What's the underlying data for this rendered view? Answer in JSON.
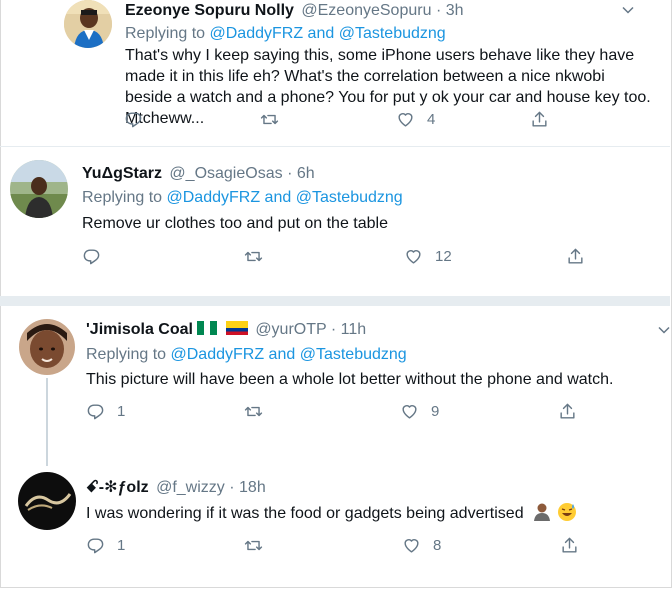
{
  "tweets": [
    {
      "name": "Ezeonye Sopuru Nolly",
      "handle": "@EzeonyeSopuru",
      "time": "· 3h",
      "replying_prefix": "Replying to",
      "reply_user1": "@DaddyFRZ",
      "reply_and": "and",
      "reply_user2": "@Tastebudzng",
      "text": "That's why I keep saying this, some iPhone users behave like they have made it in this life eh? What's the correlation between a nice nkwobi beside a watch and a phone? You for put y ok your car and house key too. Mtcheww...",
      "reply_count": "",
      "retweet_count": "",
      "like_count": "4"
    },
    {
      "name": "YuΔgStarz",
      "handle": "@_OsagieOsas",
      "time": "· 6h",
      "replying_prefix": "Replying to",
      "reply_user1": "@DaddyFRZ",
      "reply_and": "and",
      "reply_user2": "@Tastebudzng",
      "text": "Remove ur clothes too and put on the table",
      "reply_count": "",
      "retweet_count": "",
      "like_count": "12"
    },
    {
      "name": "'Jimisola Coal",
      "handle": "@yurOTP",
      "time": "· 11h",
      "replying_prefix": "Replying to",
      "reply_user1": "@DaddyFRZ",
      "reply_and": "and",
      "reply_user2": "@Tastebudzng",
      "text": "This picture will have been a whole lot better without the phone and watch.",
      "reply_count": "1",
      "retweet_count": "",
      "like_count": "9"
    },
    {
      "name": "ꗃ-✻ƒolz",
      "handle": "@f_wizzy",
      "time": "· 18h",
      "text": "I was wondering if it was the food or gadgets being advertised",
      "reply_count": "1",
      "retweet_count": "",
      "like_count": "8"
    }
  ],
  "icons": {
    "reply": "reply-icon",
    "retweet": "retweet-icon",
    "like": "like-icon",
    "share": "share-icon",
    "more": "chevron-down-icon"
  },
  "colors": {
    "link": "#1b95e0",
    "secondary_text": "#657786",
    "divider": "#e6ecf0"
  }
}
